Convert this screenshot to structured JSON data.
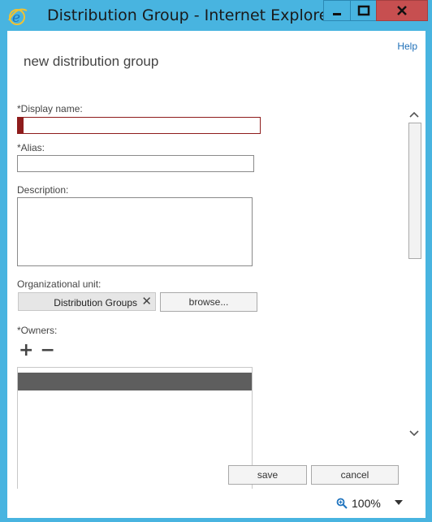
{
  "window": {
    "title": "Distribution Group - Internet Explorer",
    "icon": "internet-explorer-icon",
    "controls": [
      "minimize-icon",
      "maximize-icon",
      "close-icon"
    ],
    "close_color": "#c74f50",
    "frame_color": "#48b4e0"
  },
  "page": {
    "help_label": "Help",
    "heading": "new distribution group",
    "display_name": {
      "label": "*Display name:",
      "value": ""
    },
    "alias": {
      "label": "*Alias:",
      "value": ""
    },
    "description": {
      "label": "Description:",
      "value": ""
    },
    "org_unit": {
      "label": "Organizational unit:",
      "value": "Distribution Groups",
      "remove_icon": "close-icon",
      "browse_label": "browse..."
    },
    "owners": {
      "label": "*Owners:",
      "add_icon": "plus-icon",
      "remove_icon": "minus-icon",
      "rows": [
        ""
      ]
    },
    "save_label": "save",
    "cancel_label": "cancel",
    "error_color": "#8e1c1c"
  },
  "status": {
    "zoom": "100%",
    "zoom_icon": "zoom-magnifier-icon"
  }
}
